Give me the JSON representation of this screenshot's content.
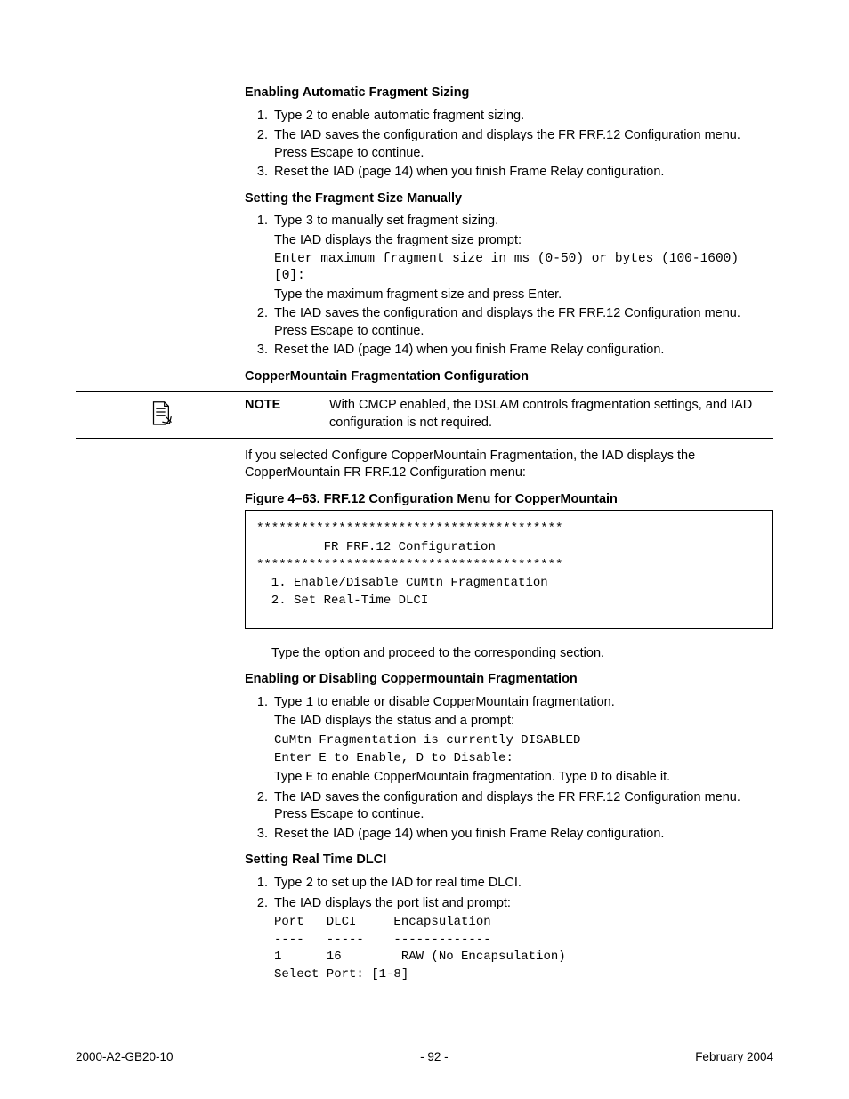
{
  "section1": {
    "heading": "Enabling Automatic Fragment Sizing",
    "step1a": "Type ",
    "step1code": "2",
    "step1b": " to enable automatic fragment sizing.",
    "step2": "The IAD saves the configuration and displays the FR FRF.12 Configuration menu. Press Escape to continue.",
    "step3": "Reset the IAD (page 14) when you finish Frame Relay configuration."
  },
  "section2": {
    "heading": "Setting the Fragment Size Manually",
    "step1a": "Type ",
    "step1code": "3",
    "step1b": " to manually set fragment sizing.",
    "step1c": "The IAD displays the fragment size prompt:",
    "step1mono": "Enter maximum fragment size in ms (0-50) or bytes (100-1600) [0]:",
    "step1d": "Type the maximum fragment size and press Enter.",
    "step2": "The IAD saves the configuration and displays the FR FRF.12 Configuration menu. Press Escape to continue.",
    "step3": "Reset the IAD (page 14) when you finish Frame Relay configuration."
  },
  "section3": {
    "heading": "CopperMountain Fragmentation Configuration",
    "noteLabel": "NOTE",
    "noteText": "With CMCP enabled, the DSLAM controls fragmentation settings, and IAD configuration is not required.",
    "intro": "If you selected Configure CopperMountain Fragmentation, the IAD displays the CopperMountain FR FRF.12 Configuration menu:",
    "figureCap": "Figure 4–63.  FRF.12 Configuration Menu for CopperMountain",
    "codebox": "*****************************************\n         FR FRF.12 Configuration\n*****************************************\n  1. Enable/Disable CuMtn Fragmentation\n  2. Set Real-Time DLCI",
    "after": "Type the option and proceed to the corresponding section."
  },
  "section4": {
    "heading": "Enabling or Disabling Coppermountain Fragmentation",
    "step1a": "Type ",
    "step1code": "1",
    "step1b": " to enable or disable CopperMountain fragmentation.",
    "step1c": "The IAD displays the status and a prompt:",
    "step1mono": "CuMtn Fragmentation is currently DISABLED\nEnter E to Enable, D to Disable:",
    "step1d_a": "Type ",
    "step1d_code1": "E",
    "step1d_b": " to enable CopperMountain fragmentation. Type ",
    "step1d_code2": "D",
    "step1d_c": " to disable it.",
    "step2": "The IAD saves the configuration and displays the FR FRF.12 Configuration menu. Press Escape to continue.",
    "step3": "Reset the IAD (page 14) when you finish Frame Relay configuration."
  },
  "section5": {
    "heading": "Setting Real Time DLCI",
    "step1a": "Type ",
    "step1code": "2",
    "step1b": " to set up the IAD for real time DLCI.",
    "step2a": "The IAD displays the port list and prompt:",
    "step2mono": "Port   DLCI     Encapsulation\n----   -----    -------------\n1      16        RAW (No Encapsulation)\nSelect Port: [1-8]"
  },
  "footer": {
    "left": "2000-A2-GB20-10",
    "center": "- 92 -",
    "right": "February 2004"
  }
}
